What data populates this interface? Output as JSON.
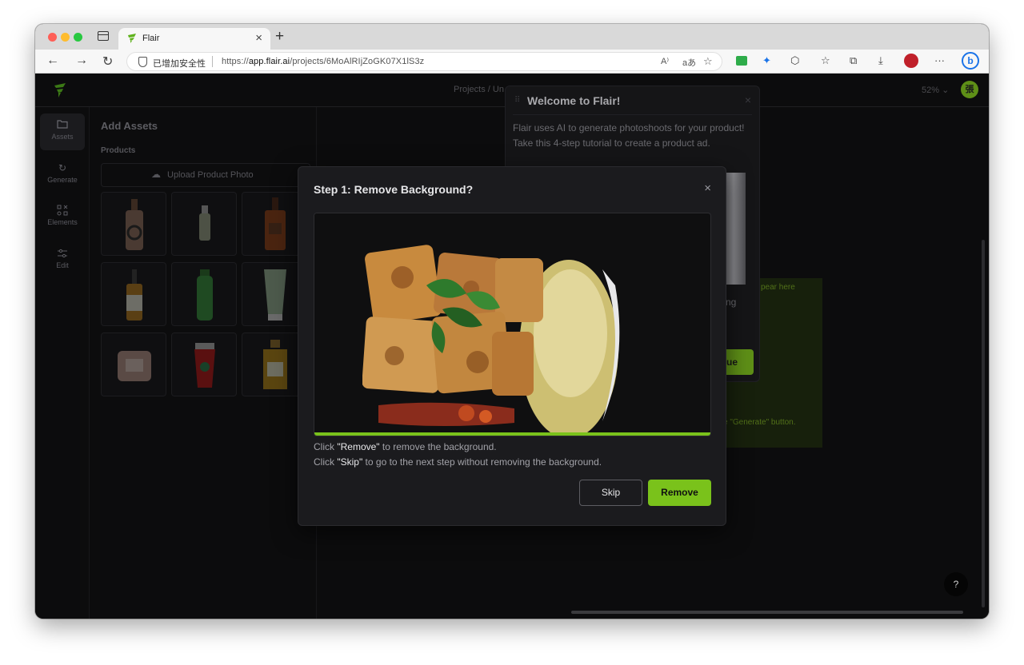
{
  "browser": {
    "tab_title": "Flair",
    "security_label": "已增加安全性",
    "url_prefix": "https://",
    "url_host": "app.flair.ai",
    "url_path": "/projects/6MoAlRIjZoGK07X1lS3z",
    "read_aloud": "A⁾",
    "translate": "aあ"
  },
  "app": {
    "breadcrumb": "Projects / Un",
    "zoom": "52%",
    "avatar_initial": "張",
    "nav": [
      {
        "label": "Assets",
        "icon": "folder-icon",
        "active": true
      },
      {
        "label": "Generate",
        "icon": "refresh-icon",
        "active": false
      },
      {
        "label": "Elements",
        "icon": "elements-icon",
        "active": false
      },
      {
        "label": "Edit",
        "icon": "sliders-icon",
        "active": false
      }
    ],
    "assets_panel": {
      "title": "Add Assets",
      "section": "Products",
      "upload_label": "Upload Product Photo"
    },
    "canvas_placeholder": {
      "line1": "pear here",
      "line2": "e \"Generate\" button."
    },
    "help_label": "?"
  },
  "welcome": {
    "title": "Welcome to Flair!",
    "body": "Flair uses AI to generate photoshoots for your product! Take this 4-step tutorial to create a product ad.",
    "partial_text": "ng",
    "button_partial": "ue"
  },
  "modal": {
    "title": "Step 1: Remove Background?",
    "line1_pre": "Click ",
    "line1_key": "\"Remove\"",
    "line1_post": " to remove the background.",
    "line2_pre": "Click ",
    "line2_key": "\"Skip\"",
    "line2_post": " to go to the next step without removing the background.",
    "skip_label": "Skip",
    "remove_label": "Remove",
    "progress": 1.0
  },
  "colors": {
    "accent": "#7ac21b",
    "modal_bg": "#1b1b1e",
    "app_bg": "#0c0c0d"
  }
}
